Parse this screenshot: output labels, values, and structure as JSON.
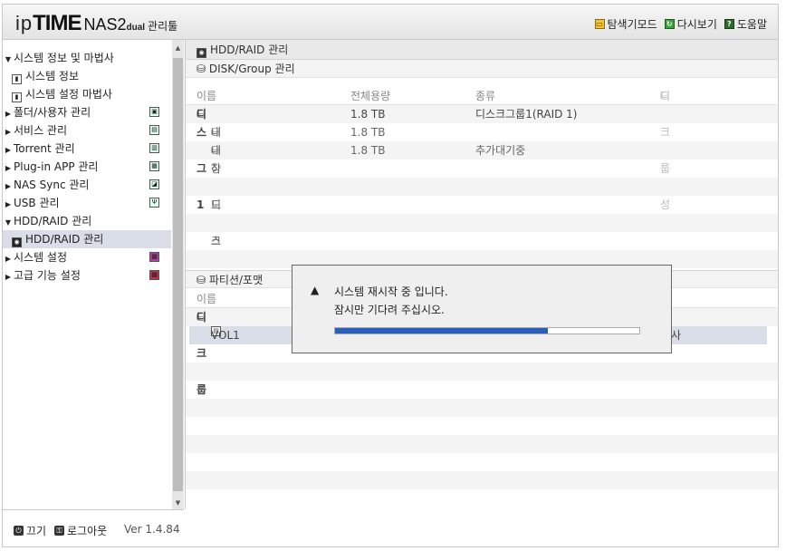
{
  "header": {
    "logo_ip": "ip",
    "logo_time": "TIME",
    "logo_model": "NAS2",
    "logo_sub": "dual",
    "logo_mgr": "관리툴",
    "menu": [
      {
        "label": "탐색기모드",
        "icon": "explorer-mode-icon"
      },
      {
        "label": "다시보기",
        "icon": "refresh-icon"
      },
      {
        "label": "도움말",
        "icon": "help-icon"
      }
    ]
  },
  "sidebar": {
    "items": [
      {
        "label": "시스템 정보 및 마법사",
        "arrow": "▼",
        "level": 0
      },
      {
        "label": "시스템 정보",
        "level": 1
      },
      {
        "label": "시스템 설정 마법사",
        "level": 1
      },
      {
        "label": "폴더/사용자 관리",
        "arrow": "▶",
        "level": 0
      },
      {
        "label": "서비스 관리",
        "arrow": "▶",
        "level": 0
      },
      {
        "label": "Torrent 관리",
        "arrow": "▶",
        "level": 0
      },
      {
        "label": "Plug-in APP 관리",
        "arrow": "▶",
        "level": 0
      },
      {
        "label": "NAS Sync 관리",
        "arrow": "▶",
        "level": 0
      },
      {
        "label": "USB 관리",
        "arrow": "▶",
        "level": 0
      },
      {
        "label": "HDD/RAID 관리",
        "arrow": "▼",
        "level": 0
      },
      {
        "label": "HDD/RAID 관리",
        "level": 1,
        "selected": true
      },
      {
        "label": "시스템 설정",
        "arrow": "▶",
        "level": 0
      },
      {
        "label": "고급 기능 설정",
        "arrow": "▶",
        "level": 0
      }
    ]
  },
  "footer": {
    "power_label": "끄기",
    "logout_label": "로그아웃",
    "version": "Ver 1.4.84"
  },
  "main": {
    "section_title": "HDD/RAID 관리",
    "disk_group_title": "DISK/Group 관리",
    "columns": {
      "name": "이름",
      "capacity": "전체용량",
      "type": "종류",
      "create": "디스크그룹 생성"
    },
    "rows": [
      {
        "name": "디스크그룹1",
        "capacity": "1.8 TB",
        "type": "디스크그룹1(RAID 1)"
      },
      {
        "name": "내장 하드디스크1",
        "capacity": "1.8 TB",
        "type": ""
      },
      {
        "name": "내장 하드디스크2",
        "capacity": "1.8 TB",
        "type": "추가대기중"
      }
    ],
    "partition_title": "파티션/포맷",
    "partition_col_name": "이름",
    "partition_rows": [
      {
        "name": "디스크그룹1",
        "tail": ""
      },
      {
        "name": "VOL1",
        "tail": "사"
      }
    ]
  },
  "dialog": {
    "line1": "시스템 재시작 중 입니다.",
    "line2": "잠시만 기다려 주십시오.",
    "progress": 0.7
  }
}
